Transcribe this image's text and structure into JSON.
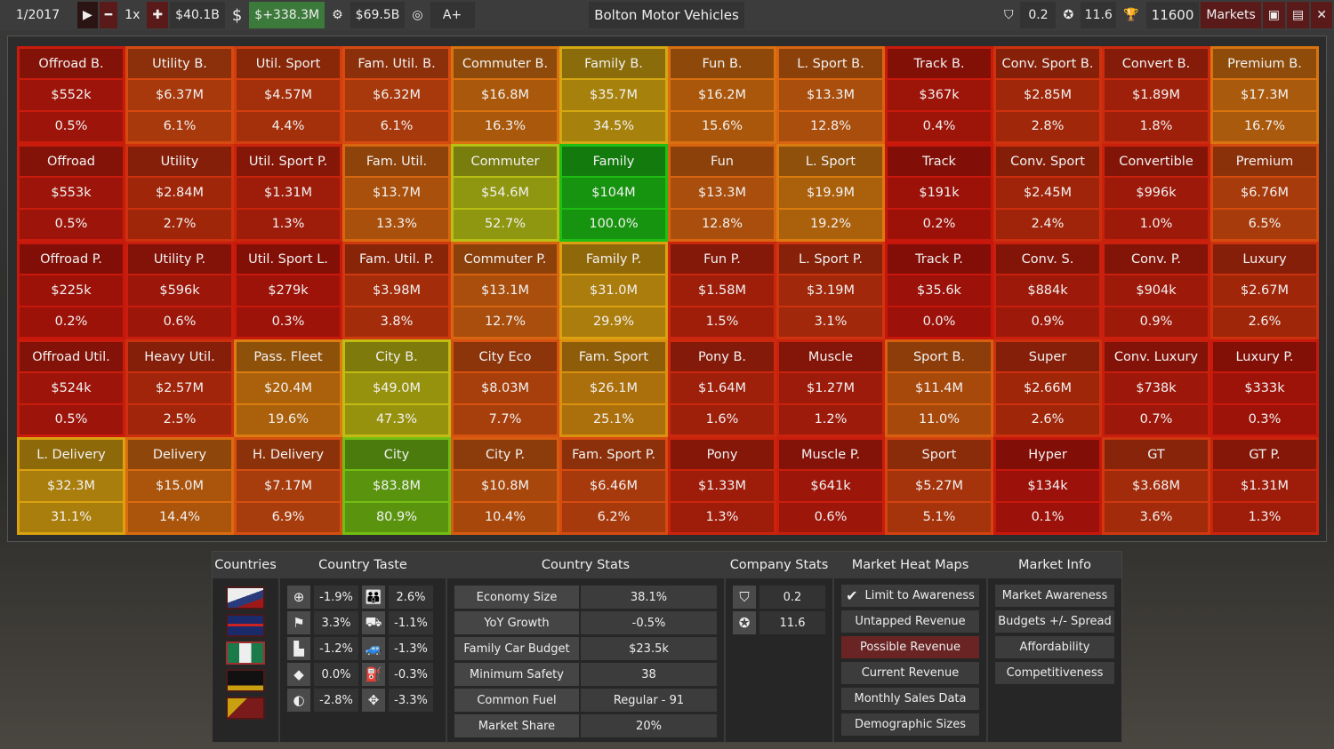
{
  "topbar": {
    "date": "1/2017",
    "speed": "1x",
    "funds": "$40.1B",
    "income": "$+338.3M",
    "market_value": "$69.5B",
    "rating": "A+",
    "company": "Bolton Motor Vehicles",
    "stat1": "0.2",
    "stat2": "11.6",
    "score": "11600",
    "markets_label": "Markets"
  },
  "grid": [
    [
      [
        "Offroad B.",
        "$552k",
        "0.5%"
      ],
      [
        "Utility B.",
        "$6.37M",
        "6.1%"
      ],
      [
        "Util. Sport",
        "$4.57M",
        "4.4%"
      ],
      [
        "Fam. Util. B.",
        "$6.32M",
        "6.1%"
      ],
      [
        "Commuter B.",
        "$16.8M",
        "16.3%"
      ],
      [
        "Family B.",
        "$35.7M",
        "34.5%"
      ],
      [
        "Fun B.",
        "$16.2M",
        "15.6%"
      ],
      [
        "L. Sport B.",
        "$13.3M",
        "12.8%"
      ],
      [
        "Track B.",
        "$367k",
        "0.4%"
      ],
      [
        "Conv. Sport B.",
        "$2.85M",
        "2.8%"
      ],
      [
        "Convert B.",
        "$1.89M",
        "1.8%"
      ],
      [
        "Premium B.",
        "$17.3M",
        "16.7%"
      ]
    ],
    [
      [
        "Offroad",
        "$553k",
        "0.5%"
      ],
      [
        "Utility",
        "$2.84M",
        "2.7%"
      ],
      [
        "Util. Sport P.",
        "$1.31M",
        "1.3%"
      ],
      [
        "Fam. Util.",
        "$13.7M",
        "13.3%"
      ],
      [
        "Commuter",
        "$54.6M",
        "52.7%"
      ],
      [
        "Family",
        "$104M",
        "100.0%"
      ],
      [
        "Fun",
        "$13.3M",
        "12.8%"
      ],
      [
        "L. Sport",
        "$19.9M",
        "19.2%"
      ],
      [
        "Track",
        "$191k",
        "0.2%"
      ],
      [
        "Conv. Sport",
        "$2.45M",
        "2.4%"
      ],
      [
        "Convertible",
        "$996k",
        "1.0%"
      ],
      [
        "Premium",
        "$6.76M",
        "6.5%"
      ]
    ],
    [
      [
        "Offroad P.",
        "$225k",
        "0.2%"
      ],
      [
        "Utility P.",
        "$596k",
        "0.6%"
      ],
      [
        "Util. Sport L.",
        "$279k",
        "0.3%"
      ],
      [
        "Fam. Util. P.",
        "$3.98M",
        "3.8%"
      ],
      [
        "Commuter P.",
        "$13.1M",
        "12.7%"
      ],
      [
        "Family P.",
        "$31.0M",
        "29.9%"
      ],
      [
        "Fun P.",
        "$1.58M",
        "1.5%"
      ],
      [
        "L. Sport P.",
        "$3.19M",
        "3.1%"
      ],
      [
        "Track P.",
        "$35.6k",
        "0.0%"
      ],
      [
        "Conv. S.",
        "$884k",
        "0.9%"
      ],
      [
        "Conv. P.",
        "$904k",
        "0.9%"
      ],
      [
        "Luxury",
        "$2.67M",
        "2.6%"
      ]
    ],
    [
      [
        "Offroad Util.",
        "$524k",
        "0.5%"
      ],
      [
        "Heavy Util.",
        "$2.57M",
        "2.5%"
      ],
      [
        "Pass. Fleet",
        "$20.4M",
        "19.6%"
      ],
      [
        "City B.",
        "$49.0M",
        "47.3%"
      ],
      [
        "City Eco",
        "$8.03M",
        "7.7%"
      ],
      [
        "Fam. Sport",
        "$26.1M",
        "25.1%"
      ],
      [
        "Pony B.",
        "$1.64M",
        "1.6%"
      ],
      [
        "Muscle",
        "$1.27M",
        "1.2%"
      ],
      [
        "Sport B.",
        "$11.4M",
        "11.0%"
      ],
      [
        "Super",
        "$2.66M",
        "2.6%"
      ],
      [
        "Conv. Luxury",
        "$738k",
        "0.7%"
      ],
      [
        "Luxury P.",
        "$333k",
        "0.3%"
      ]
    ],
    [
      [
        "L. Delivery",
        "$32.3M",
        "31.1%"
      ],
      [
        "Delivery",
        "$15.0M",
        "14.4%"
      ],
      [
        "H. Delivery",
        "$7.17M",
        "6.9%"
      ],
      [
        "City",
        "$83.8M",
        "80.9%"
      ],
      [
        "City P.",
        "$10.8M",
        "10.4%"
      ],
      [
        "Fam. Sport P.",
        "$6.46M",
        "6.2%"
      ],
      [
        "Pony",
        "$1.33M",
        "1.3%"
      ],
      [
        "Muscle P.",
        "$641k",
        "0.6%"
      ],
      [
        "Sport",
        "$5.27M",
        "5.1%"
      ],
      [
        "Hyper",
        "$134k",
        "0.1%"
      ],
      [
        "GT",
        "$3.68M",
        "3.6%"
      ],
      [
        "GT P.",
        "$1.31M",
        "1.3%"
      ]
    ]
  ],
  "panels": {
    "countries": "Countries",
    "taste": "Country Taste",
    "stats": "Country Stats",
    "company": "Company Stats",
    "heat": "Market Heat Maps",
    "info": "Market Info"
  },
  "taste": [
    [
      "steering-wheel-icon",
      "-1.9%",
      "family-icon",
      "2.6%"
    ],
    [
      "checkered-flag-icon",
      "3.3%",
      "utility-truck-icon",
      "-1.1%"
    ],
    [
      "seat-icon",
      "-1.2%",
      "offroad-icon",
      "-1.3%"
    ],
    [
      "diamond-icon",
      "0.0%",
      "fuel-can-icon",
      "-0.3%"
    ],
    [
      "safety-icon",
      "-2.8%",
      "handling-icon",
      "-3.3%"
    ]
  ],
  "country_stats": [
    [
      "Economy Size",
      "38.1%"
    ],
    [
      "YoY Growth",
      "-0.5%"
    ],
    [
      "Family Car Budget",
      "$23.5k"
    ],
    [
      "Minimum Safety",
      "38"
    ],
    [
      "Common Fuel",
      "Regular - 91"
    ],
    [
      "Market Share",
      "20%"
    ]
  ],
  "company_stats": [
    "0.2",
    "11.6"
  ],
  "heat_maps": {
    "items": [
      "Limit to Awareness",
      "Untapped Revenue",
      "Possible Revenue",
      "Current Revenue",
      "Monthly Sales Data",
      "Demographic Sizes"
    ],
    "checked": true,
    "selected": "Possible Revenue"
  },
  "market_info": [
    "Market Awareness",
    "Budgets +/- Spread",
    "Affordability",
    "Competitiveness"
  ]
}
